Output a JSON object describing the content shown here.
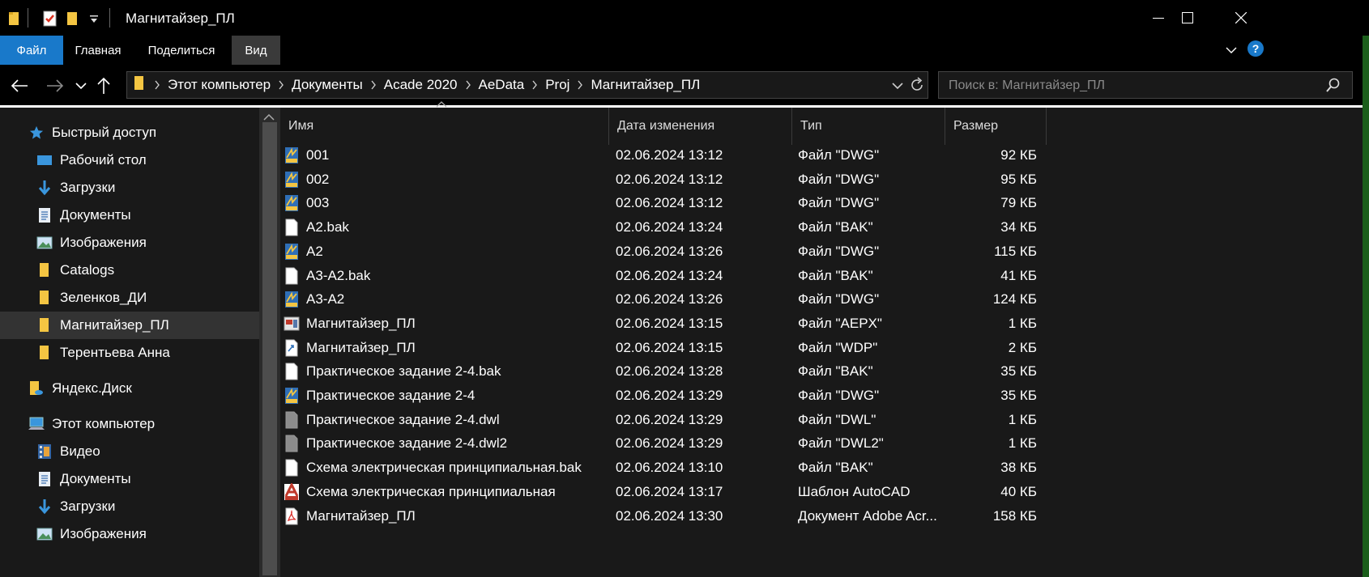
{
  "window": {
    "title": "Магнитайзер_ПЛ"
  },
  "ribbon": {
    "tabs": [
      {
        "label": "Файл"
      },
      {
        "label": "Главная"
      },
      {
        "label": "Поделиться"
      },
      {
        "label": "Вид"
      }
    ],
    "help": "?"
  },
  "address": {
    "crumbs": [
      "Этот компьютер",
      "Документы",
      "Acade 2020",
      "AeData",
      "Proj",
      "Магнитайзер_ПЛ"
    ]
  },
  "search": {
    "placeholder": "Поиск в: Магнитайзер_ПЛ"
  },
  "nav": {
    "items": [
      {
        "label": "Быстрый доступ",
        "icon": "star-icon"
      },
      {
        "label": "Рабочий стол",
        "icon": "desktop-icon",
        "pinned": true
      },
      {
        "label": "Загрузки",
        "icon": "download-icon",
        "pinned": true
      },
      {
        "label": "Документы",
        "icon": "document-icon",
        "pinned": true
      },
      {
        "label": "Изображения",
        "icon": "pictures-icon",
        "pinned": true
      },
      {
        "label": "Catalogs",
        "icon": "folder-icon"
      },
      {
        "label": "Зеленков_ДИ",
        "icon": "folder-icon"
      },
      {
        "label": "Магнитайзер_ПЛ",
        "icon": "folder-icon",
        "selected": true
      },
      {
        "label": "Терентьева Анна",
        "icon": "folder-icon"
      },
      {
        "label": "Яндекс.Диск",
        "icon": "cloud-folder-icon"
      },
      {
        "label": "Этот компьютер",
        "icon": "computer-icon"
      },
      {
        "label": "Видео",
        "icon": "video-icon"
      },
      {
        "label": "Документы",
        "icon": "document-icon"
      },
      {
        "label": "Загрузки",
        "icon": "download-icon"
      },
      {
        "label": "Изображения",
        "icon": "pictures-icon"
      }
    ]
  },
  "columns": {
    "name": "Имя",
    "date": "Дата изменения",
    "type": "Тип",
    "size": "Размер"
  },
  "files": [
    {
      "name": "001",
      "date": "02.06.2024 13:12",
      "type": "Файл \"DWG\"",
      "size": "92 КБ",
      "icon": "dwg-icon"
    },
    {
      "name": "002",
      "date": "02.06.2024 13:12",
      "type": "Файл \"DWG\"",
      "size": "95 КБ",
      "icon": "dwg-icon"
    },
    {
      "name": "003",
      "date": "02.06.2024 13:12",
      "type": "Файл \"DWG\"",
      "size": "79 КБ",
      "icon": "dwg-icon"
    },
    {
      "name": "A2.bak",
      "date": "02.06.2024 13:24",
      "type": "Файл \"BAK\"",
      "size": "34 КБ",
      "icon": "blank-file-icon"
    },
    {
      "name": "A2",
      "date": "02.06.2024 13:26",
      "type": "Файл \"DWG\"",
      "size": "115 КБ",
      "icon": "dwg-icon"
    },
    {
      "name": "A3-A2.bak",
      "date": "02.06.2024 13:24",
      "type": "Файл \"BAK\"",
      "size": "41 КБ",
      "icon": "blank-file-icon"
    },
    {
      "name": "A3-A2",
      "date": "02.06.2024 13:26",
      "type": "Файл \"DWG\"",
      "size": "124 КБ",
      "icon": "dwg-icon"
    },
    {
      "name": "Магнитайзер_ПЛ",
      "date": "02.06.2024 13:15",
      "type": "Файл \"AEPX\"",
      "size": "1 КБ",
      "icon": "aepx-icon"
    },
    {
      "name": "Магнитайзер_ПЛ",
      "date": "02.06.2024 13:15",
      "type": "Файл \"WDP\"",
      "size": "2 КБ",
      "icon": "wdp-icon"
    },
    {
      "name": "Практическое задание 2-4.bak",
      "date": "02.06.2024 13:28",
      "type": "Файл \"BAK\"",
      "size": "35 КБ",
      "icon": "blank-file-icon"
    },
    {
      "name": "Практическое задание 2-4",
      "date": "02.06.2024 13:29",
      "type": "Файл \"DWG\"",
      "size": "35 КБ",
      "icon": "dwg-icon"
    },
    {
      "name": "Практическое задание 2-4.dwl",
      "date": "02.06.2024 13:29",
      "type": "Файл \"DWL\"",
      "size": "1 КБ",
      "icon": "gray-file-icon"
    },
    {
      "name": "Практическое задание 2-4.dwl2",
      "date": "02.06.2024 13:29",
      "type": "Файл \"DWL2\"",
      "size": "1 КБ",
      "icon": "gray-file-icon"
    },
    {
      "name": "Схема электрическая принципиальная.bak",
      "date": "02.06.2024 13:10",
      "type": "Файл \"BAK\"",
      "size": "38 КБ",
      "icon": "blank-file-icon"
    },
    {
      "name": "Схема электрическая принципиальная",
      "date": "02.06.2024 13:17",
      "type": "Шаблон AutoCAD",
      "size": "40 КБ",
      "icon": "dwt-icon"
    },
    {
      "name": "Магнитайзер_ПЛ",
      "date": "02.06.2024 13:30",
      "type": "Документ Adobe Acr...",
      "size": "158 КБ",
      "icon": "pdf-icon"
    }
  ]
}
